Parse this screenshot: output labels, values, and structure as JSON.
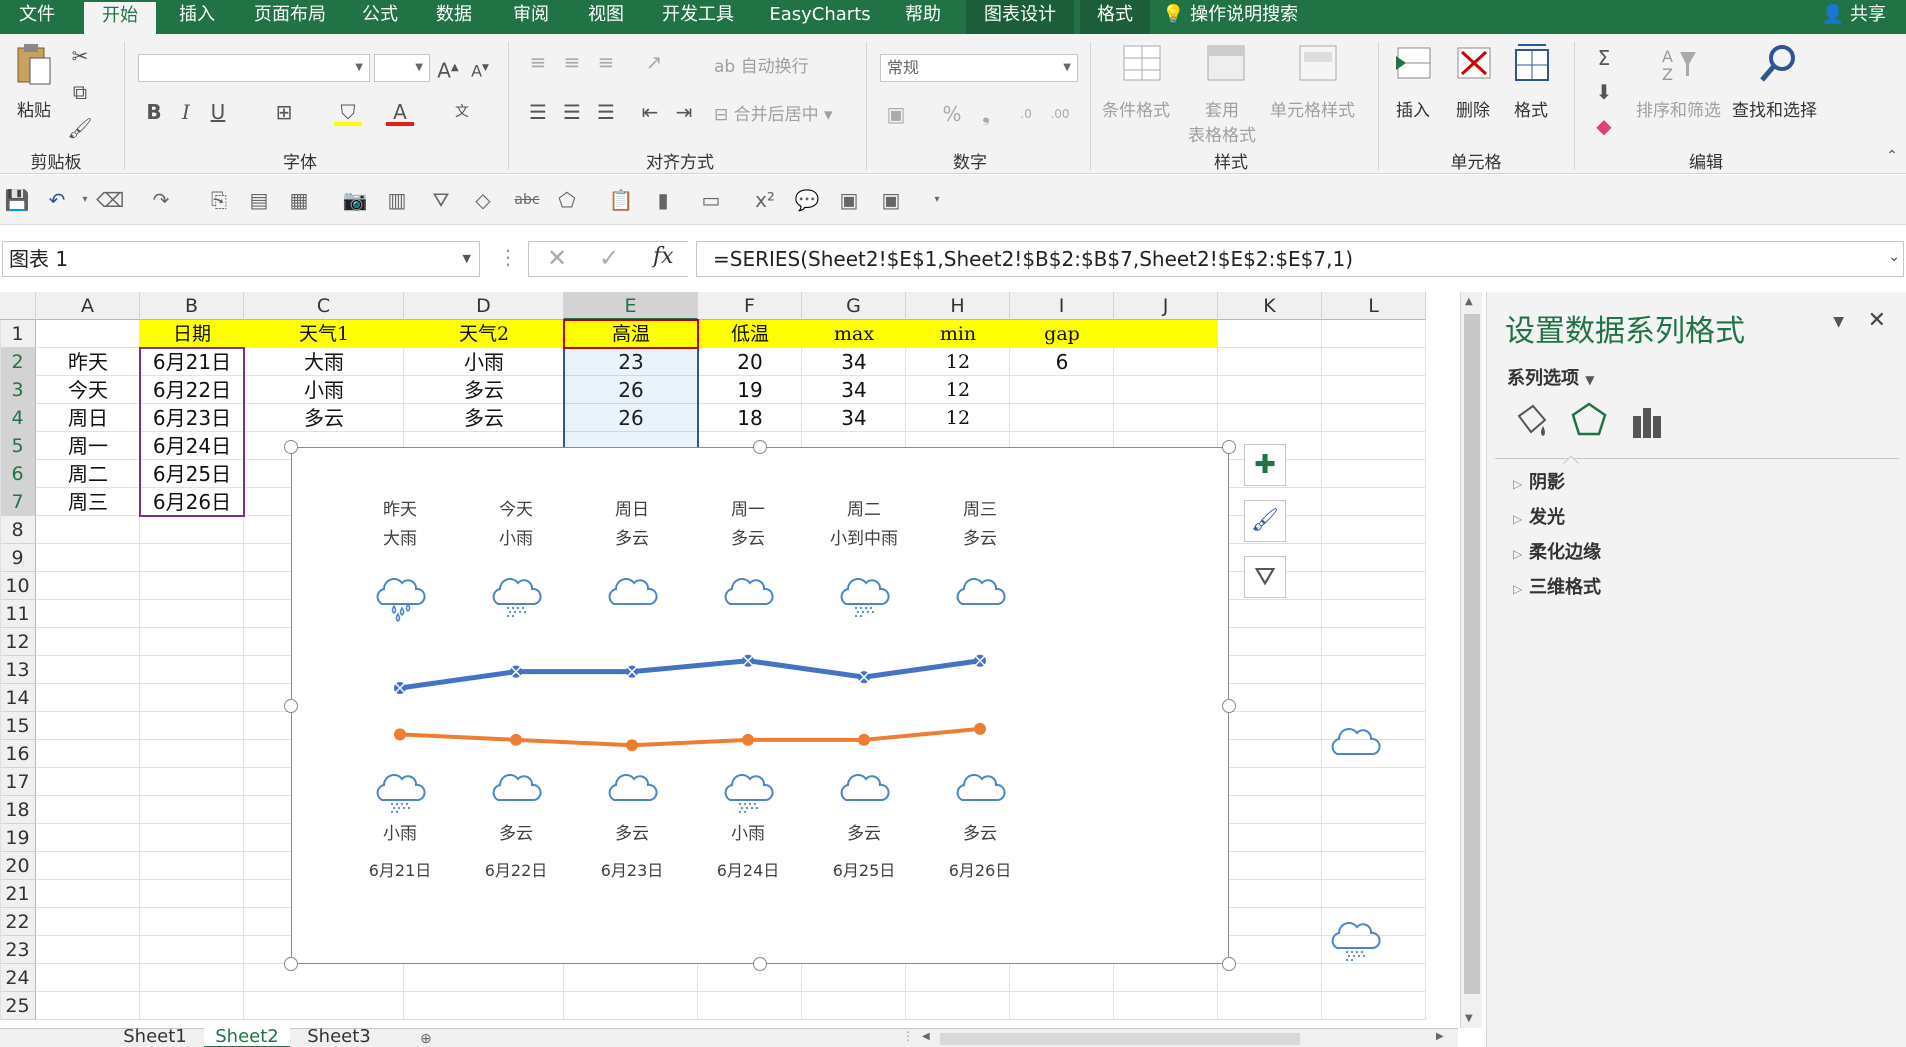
{
  "ribbon_tabs": [
    {
      "label": "文件",
      "x": 0,
      "w": 74
    },
    {
      "label": "开始",
      "x": 84,
      "w": 72,
      "active": true
    },
    {
      "label": "插入",
      "x": 160,
      "w": 74
    },
    {
      "label": "页面布局",
      "x": 240,
      "w": 100
    },
    {
      "label": "公式",
      "x": 346,
      "w": 68
    },
    {
      "label": "数据",
      "x": 420,
      "w": 68
    },
    {
      "label": "审阅",
      "x": 496,
      "w": 70
    },
    {
      "label": "视图",
      "x": 572,
      "w": 68
    },
    {
      "label": "开发工具",
      "x": 648,
      "w": 100
    },
    {
      "label": "EasyCharts",
      "x": 760,
      "w": 120
    },
    {
      "label": "帮助",
      "x": 888,
      "w": 70
    },
    {
      "label": "图表设计",
      "x": 966,
      "w": 108,
      "ctx": true
    },
    {
      "label": "格式",
      "x": 1080,
      "w": 70,
      "ctx": true
    }
  ],
  "tell_me": "操作说明搜索",
  "share": "共享",
  "groups": {
    "clipboard": "剪贴板",
    "font": "字体",
    "alignment": "对齐方式",
    "number": "数字",
    "styles": "样式",
    "cells": "单元格",
    "editing": "编辑"
  },
  "ribbon_buttons": {
    "paste": "粘贴",
    "wrap_text": "自动换行",
    "merge_center": "合并后居中",
    "number_format": "常规",
    "conditional_format": "条件格式",
    "table_format_1": "套用",
    "table_format_2": "表格格式",
    "cell_styles": "单元格样式",
    "insert": "插入",
    "delete": "删除",
    "format": "格式",
    "sort_filter": "排序和筛选",
    "find_select": "查找和选择"
  },
  "name_box": "图表 1",
  "formula": "=SERIES(Sheet2!$E$1,Sheet2!$B$2:$B$7,Sheet2!$E$2:$E$7,1)",
  "columns": [
    "A",
    "B",
    "C",
    "D",
    "E",
    "F",
    "G",
    "H",
    "I",
    "J",
    "K",
    "L"
  ],
  "rows": [
    "1",
    "2",
    "3",
    "4",
    "5",
    "6",
    "7",
    "8",
    "9",
    "10",
    "11",
    "12",
    "13",
    "14",
    "15",
    "16",
    "17",
    "18",
    "19",
    "20",
    "21",
    "22",
    "23",
    "24",
    "25"
  ],
  "header_row": [
    "日期",
    "天气1",
    "天气2",
    "高温",
    "低温",
    "max",
    "min",
    "gap"
  ],
  "table_rows": [
    {
      "a": "昨天",
      "b": "6月21日",
      "c": "大雨",
      "d": "小雨",
      "e": "23",
      "f": "20",
      "g": "34",
      "h": "12",
      "i": "6"
    },
    {
      "a": "今天",
      "b": "6月22日",
      "c": "小雨",
      "d": "多云",
      "e": "26",
      "f": "19",
      "g": "34",
      "h": "12",
      "i": ""
    },
    {
      "a": "周日",
      "b": "6月23日",
      "c": "多云",
      "d": "多云",
      "e": "26",
      "f": "18",
      "g": "34",
      "h": "12",
      "i": ""
    },
    {
      "a": "周一",
      "b": "6月24日",
      "c": "",
      "d": "",
      "e": "",
      "f": "",
      "g": "",
      "h": "",
      "i": ""
    },
    {
      "a": "周二",
      "b": "6月25日",
      "c": "",
      "d": "",
      "e": "",
      "f": "",
      "g": "",
      "h": "",
      "i": ""
    },
    {
      "a": "周三",
      "b": "6月26日",
      "c": "",
      "d": "",
      "e": "",
      "f": "",
      "g": "",
      "h": "",
      "i": ""
    }
  ],
  "chart_data": {
    "type": "line",
    "categories": [
      "6月21日",
      "6月22日",
      "6月23日",
      "6月24日",
      "6月25日",
      "6月26日"
    ],
    "top_day_labels": [
      "昨天",
      "今天",
      "周日",
      "周一",
      "周二",
      "周三"
    ],
    "top_weather_labels": [
      "大雨",
      "小雨",
      "多云",
      "多云",
      "小到中雨",
      "多云"
    ],
    "bottom_weather_labels": [
      "小雨",
      "多云",
      "多云",
      "小雨",
      "多云",
      "多云"
    ],
    "top_icons": [
      "heavy-rain-icon",
      "light-rain-icon",
      "cloud-icon",
      "cloud-icon",
      "light-rain-icon",
      "cloud-icon"
    ],
    "bottom_icons": [
      "light-rain-icon",
      "cloud-icon",
      "cloud-icon",
      "light-rain-icon",
      "cloud-icon",
      "cloud-icon"
    ],
    "series": [
      {
        "name": "高温",
        "values": [
          23,
          26,
          26,
          28,
          25,
          28
        ],
        "color": "#4472c4"
      },
      {
        "name": "低温",
        "values": [
          20,
          19,
          18,
          19,
          19,
          21
        ],
        "color": "#ed7d31"
      }
    ],
    "ylim": [
      12,
      34
    ]
  },
  "sheets": [
    "Sheet1",
    "Sheet2",
    "Sheet3"
  ],
  "active_sheet": "Sheet2",
  "pane": {
    "title": "设置数据系列格式",
    "subtitle": "系列选项",
    "sections": [
      "阴影",
      "发光",
      "柔化边缘",
      "三维格式"
    ]
  },
  "colors": {
    "brand": "#217346",
    "high_series": "#4472c4",
    "low_series": "#ed7d31",
    "header_fill": "#ffff00",
    "icon_blue": "#4a86c8"
  }
}
